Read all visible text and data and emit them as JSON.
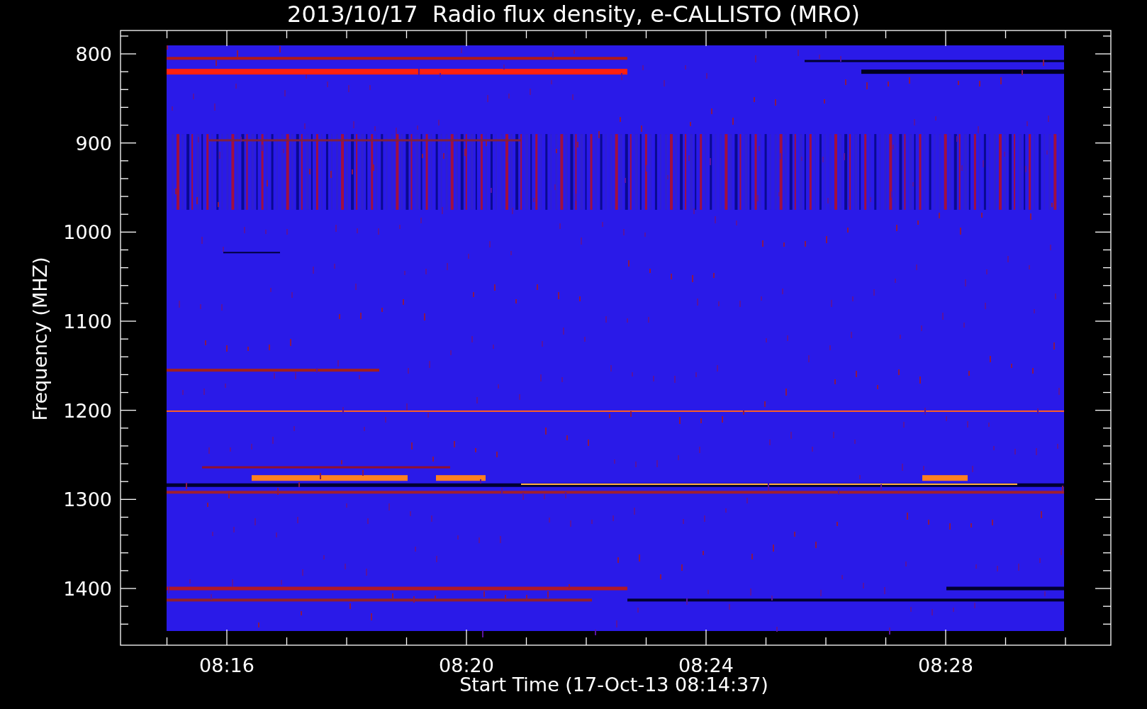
{
  "title": "2013/10/17  Radio flux density, e-CALLISTO (MRO)",
  "y_axis": {
    "label": "Frequency (MHZ)",
    "ticks": [
      "800",
      "900",
      "1000",
      "1100",
      "1200",
      "1300",
      "1400"
    ]
  },
  "x_axis": {
    "label": "Start Time (17-Oct-13 08:14:37)",
    "ticks": [
      "08:16",
      "08:20",
      "08:24",
      "08:28"
    ]
  }
}
